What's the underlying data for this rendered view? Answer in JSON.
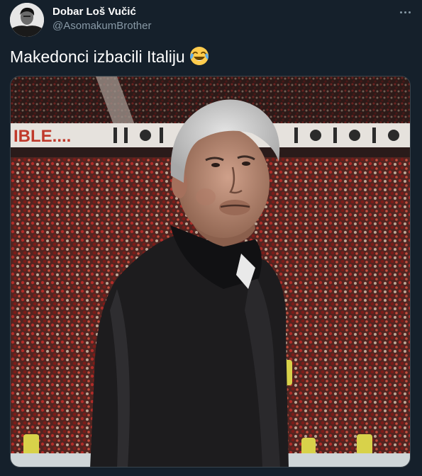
{
  "tweet": {
    "author": {
      "display_name": "Dobar Loš Vučić",
      "handle": "@AsomakumBrother",
      "avatar_icon": "profile-avatar"
    },
    "more_icon": "more-horizontal-icon",
    "text": "Makedonci izbacili Italiju",
    "emoji": "face-with-tears-of-joy-emoji",
    "media": {
      "type": "photo",
      "banner_text": "IBLE...."
    }
  },
  "colors": {
    "background": "#15202b",
    "primary_text": "#ffffff",
    "secondary_text": "#8899a6",
    "border": "#38444d"
  }
}
